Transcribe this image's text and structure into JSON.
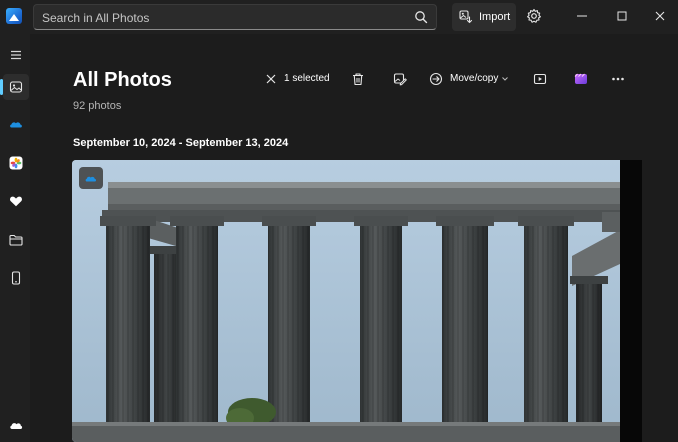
{
  "search": {
    "placeholder": "Search in All Photos"
  },
  "toolbar_top": {
    "import_label": "Import"
  },
  "icons": {
    "app": "photos-app-icon",
    "search": "search-icon",
    "import": "import-icon",
    "settings": "gear-icon",
    "minimize": "minimize-icon",
    "maximize": "maximize-icon",
    "close": "close-icon"
  },
  "sidebar": {
    "items": [
      {
        "name": "menu",
        "icon": "hamburger-icon"
      },
      {
        "name": "gallery",
        "icon": "gallery-icon",
        "active": true
      },
      {
        "name": "onedrive",
        "icon": "onedrive-icon"
      },
      {
        "name": "icloud-photos",
        "icon": "icloud-photos-icon"
      },
      {
        "name": "favorites",
        "icon": "heart-icon"
      },
      {
        "name": "folders",
        "icon": "folder-icon"
      },
      {
        "name": "phone",
        "icon": "phone-icon"
      },
      {
        "name": "cloud",
        "icon": "cloud-icon"
      }
    ]
  },
  "header": {
    "title": "All Photos",
    "count": "92 photos"
  },
  "selection": {
    "selected_label": "1 selected",
    "move_copy_label": "Move/copy"
  },
  "group": {
    "date_range": "September 10, 2024 - September 13, 2024"
  },
  "colors": {
    "accent": "#60cdff",
    "background": "#1c1c1c",
    "chrome": "#202020",
    "onedrive_blue": "#1e8fe0"
  }
}
